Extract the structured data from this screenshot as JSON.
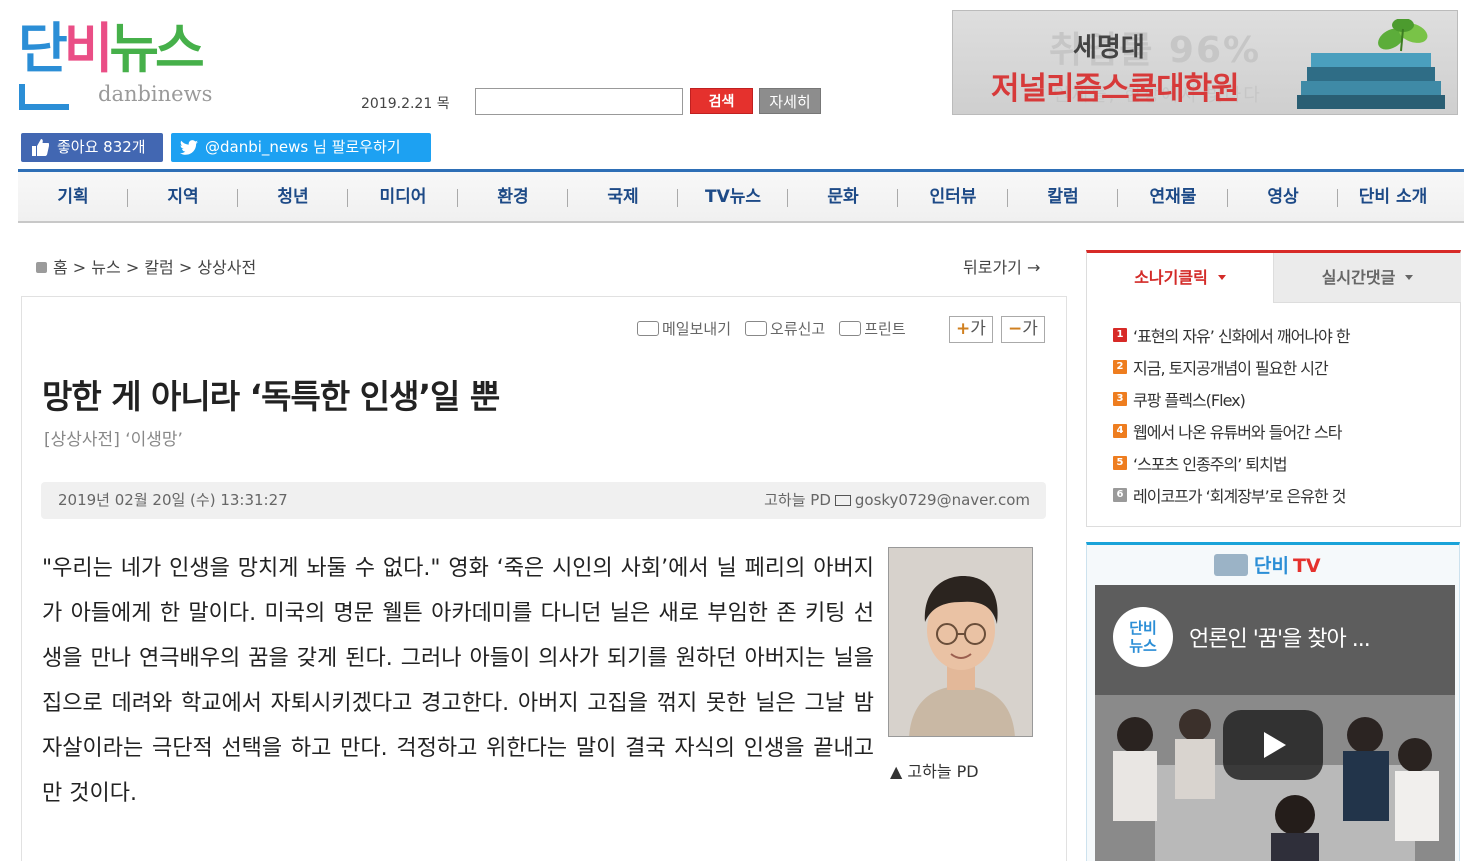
{
  "header": {
    "logo_text": [
      "단",
      "비",
      "뉴스"
    ],
    "logo_sub": "danbinews",
    "date": "2019.2.21 목",
    "search_placeholder": "",
    "search_label": "검색",
    "detail_label": "자세히"
  },
  "banner": {
    "ghost_text": "취업률 96%",
    "ghost_text2": "인재들, 현장에서 빛나다",
    "line1": "세명대",
    "line2": "저널리즘스쿨대학원"
  },
  "social": {
    "facebook_label": "좋아요 832개",
    "twitter_label": "@danbi_news 님 팔로우하기"
  },
  "nav": {
    "items": [
      "기획",
      "지역",
      "청년",
      "미디어",
      "환경",
      "국제",
      "TV뉴스",
      "문화",
      "인터뷰",
      "칼럼",
      "연재물",
      "영상",
      "단비 소개"
    ]
  },
  "breadcrumb": {
    "path": "홈 > 뉴스 > 칼럼 > 상상사전",
    "back": "뒤로가기"
  },
  "tools": {
    "email": "메일보내기",
    "report": "오류신고",
    "print": "프린트",
    "font_up": "가",
    "font_down": "가"
  },
  "article": {
    "title": "망한 게 아니라 ‘독특한 인생’일 뿐",
    "subtitle": "[상상사전] ‘이생망’",
    "datetime": "2019년 02월 20일 (수) 13:31:27",
    "author": "고하늘 PD",
    "email": "gosky0729@naver.com",
    "body": "\"우리는 네가 인생을 망치게 놔둘 수 없다.\" 영화 ‘죽은 시인의 사회’에서 닐 페리의 아버지가 아들에게 한 말이다. 미국의 명문 웰튼 아카데미를 다니던 닐은 새로 부임한 존 키팅 선생을 만나 연극배우의 꿈을 갖게 된다. 그러나 아들이 의사가 되기를 원하던 아버지는 닐을 집으로 데려와 학교에서 자퇴시키겠다고 경고한다. 아버지 고집을 꺾지 못한 닐은 그날 밤 자살이라는 극단적 선택을 하고 만다. 걱정하고 위한다는 말이 결국 자식의 인생을 끝내고 만 것이다.",
    "photo_caption": "▲ 고하늘 PD"
  },
  "ranking": {
    "tab_active": "소나기클릭",
    "tab_inactive": "실시간댓글",
    "items": [
      {
        "num": "1",
        "title": "‘표현의 자유’ 신화에서 깨어나야 한"
      },
      {
        "num": "2",
        "title": "지금, 토지공개념이 필요한 시간"
      },
      {
        "num": "3",
        "title": "쿠팡 플렉스(Flex)"
      },
      {
        "num": "4",
        "title": "웹에서 나온 유튜버와 들어간 스타"
      },
      {
        "num": "5",
        "title": "‘스포츠 인종주의’ 퇴치법"
      },
      {
        "num": "6",
        "title": "레이코프가 ‘회계장부’로 은유한 것"
      }
    ],
    "colors": [
      "#d72a27",
      "#ee7d1f",
      "#ee7d1f",
      "#ee7d1f",
      "#ee7d1f",
      "#9a9a9a"
    ]
  },
  "tv": {
    "logo_main": "단비",
    "logo_tv": "TV",
    "channel_text": "단비\n뉴스",
    "video_title": "언론인 '꿈'을 찾아 ..."
  }
}
